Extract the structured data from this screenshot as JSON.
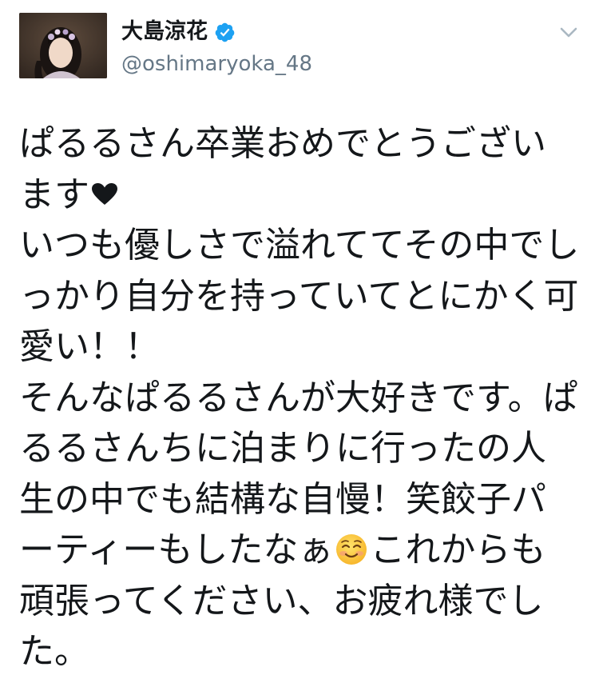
{
  "user": {
    "display_name": "大島涼花",
    "handle": "@oshimaryoka_48",
    "verified": true,
    "avatar_icon": "profile-photo"
  },
  "menu": {
    "icon": "chevron-down-icon"
  },
  "tweet": {
    "lines": [
      "ぱるるさん卒業おめでとうござい",
      "ます",
      "いつも優しさで溢れててその中でし",
      "っかり自分を持っていてとにかく可",
      "愛い！！",
      "そんなぱるるさんが大好きです。ぱ",
      "るるさんちに泊まりに行ったの人",
      "生の中でも結構な自慢！笑餃子パ",
      "ーティーもしたなぁ",
      "これからも",
      "頑張ってください、お疲れ様でし",
      "た。"
    ],
    "emojis": {
      "heart": "heart-emoji",
      "smile": "smiling-face-emoji"
    }
  },
  "colors": {
    "text": "#14171a",
    "secondary": "#657786",
    "verified_blue": "#1da1f2",
    "chevron": "#aab8c2"
  }
}
